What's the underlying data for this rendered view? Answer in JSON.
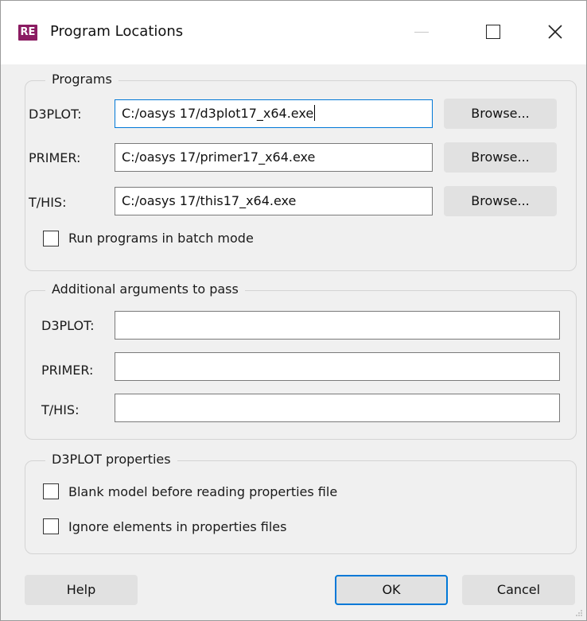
{
  "window": {
    "title": "Program Locations",
    "app_icon_text": "RE",
    "controls": {
      "minimize": "minimize-icon",
      "maximize": "maximize-icon",
      "close": "close-icon"
    }
  },
  "programs": {
    "legend": "Programs",
    "rows": [
      {
        "label": "D3PLOT:",
        "value": "C:/oasys 17/d3plot17_x64.exe",
        "browse": "Browse..."
      },
      {
        "label": "PRIMER:",
        "value": "C:/oasys 17/primer17_x64.exe",
        "browse": "Browse..."
      },
      {
        "label": "T/HIS:",
        "value": "C:/oasys 17/this17_x64.exe",
        "browse": "Browse..."
      }
    ],
    "batch_mode": {
      "label": "Run programs in batch mode",
      "checked": false
    }
  },
  "arguments": {
    "legend": "Additional arguments to pass",
    "rows": [
      {
        "label": "D3PLOT:",
        "value": ""
      },
      {
        "label": "PRIMER:",
        "value": ""
      },
      {
        "label": "T/HIS:",
        "value": ""
      }
    ]
  },
  "d3plot_props": {
    "legend": "D3PLOT properties",
    "options": [
      {
        "label": "Blank model before reading properties file",
        "checked": false
      },
      {
        "label": "Ignore elements in properties files",
        "checked": false
      }
    ]
  },
  "footer": {
    "help": "Help",
    "ok": "OK",
    "cancel": "Cancel"
  },
  "colors": {
    "accent": "#0078d7",
    "app_icon": "#8b1c62",
    "button": "#e1e1e1",
    "dialog_bg": "#f0f0f0"
  }
}
